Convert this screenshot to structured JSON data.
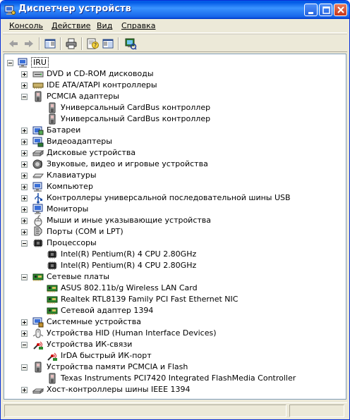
{
  "window": {
    "title": "Диспетчер устройств",
    "title_color": "#ffffff",
    "titlebar_color": "#0058e6"
  },
  "menu": [
    {
      "label": "Консоль",
      "name": "menu-console"
    },
    {
      "label": "Действие",
      "name": "menu-action"
    },
    {
      "label": "Вид",
      "name": "menu-view"
    },
    {
      "label": "Справка",
      "name": "menu-help"
    }
  ],
  "toolbar": [
    {
      "icon": "back-arrow-icon"
    },
    {
      "icon": "forward-arrow-icon"
    },
    {
      "icon": "show-hide-console-tree-icon"
    },
    {
      "icon": "print-icon"
    },
    {
      "icon": "properties-help-icon"
    },
    {
      "icon": "export-list-icon"
    },
    {
      "icon": "scan-hardware-icon"
    }
  ],
  "tree": [
    {
      "level": 0,
      "label": "IRU",
      "icon": "computer-icon",
      "expander": "minus",
      "selected": true
    },
    {
      "level": 1,
      "label": "DVD и CD-ROM дисководы",
      "icon": "cdrom-icon",
      "expander": "plus"
    },
    {
      "level": 1,
      "label": "IDE ATA/ATAPI контроллеры",
      "icon": "ide-controller-icon",
      "expander": "plus"
    },
    {
      "level": 1,
      "label": "PCMCIA адаптеры",
      "icon": "pcmcia-icon",
      "expander": "minus"
    },
    {
      "level": 2,
      "label": "Универсальный CardBus контроллер",
      "icon": "pcmcia-icon",
      "expander": ""
    },
    {
      "level": 2,
      "label": "Универсальный CardBus контроллер",
      "icon": "pcmcia-icon",
      "expander": ""
    },
    {
      "level": 1,
      "label": "Батареи",
      "icon": "battery-icon",
      "expander": "plus"
    },
    {
      "level": 1,
      "label": "Видеоадаптеры",
      "icon": "display-adapter-icon",
      "expander": "plus"
    },
    {
      "level": 1,
      "label": "Дисковые устройства",
      "icon": "disk-drive-icon",
      "expander": "plus"
    },
    {
      "level": 1,
      "label": "Звуковые, видео и игровые устройства",
      "icon": "sound-icon",
      "expander": "plus"
    },
    {
      "level": 1,
      "label": "Клавиатуры",
      "icon": "keyboard-icon",
      "expander": "plus"
    },
    {
      "level": 1,
      "label": "Компьютер",
      "icon": "computer-icon",
      "expander": "plus"
    },
    {
      "level": 1,
      "label": "Контроллеры универсальной последовательной шины USB",
      "icon": "usb-icon",
      "expander": "plus"
    },
    {
      "level": 1,
      "label": "Мониторы",
      "icon": "monitor-icon",
      "expander": "plus"
    },
    {
      "level": 1,
      "label": "Мыши и иные указывающие устройства",
      "icon": "mouse-icon",
      "expander": "plus"
    },
    {
      "level": 1,
      "label": "Порты (COM и LPT)",
      "icon": "port-icon",
      "expander": "plus"
    },
    {
      "level": 1,
      "label": "Процессоры",
      "icon": "processor-icon",
      "expander": "minus"
    },
    {
      "level": 2,
      "label": "Intel(R) Pentium(R) 4 CPU 2.80GHz",
      "icon": "processor-icon",
      "expander": ""
    },
    {
      "level": 2,
      "label": "Intel(R) Pentium(R) 4 CPU 2.80GHz",
      "icon": "processor-icon",
      "expander": ""
    },
    {
      "level": 1,
      "label": "Сетевые платы",
      "icon": "network-card-icon",
      "expander": "minus"
    },
    {
      "level": 2,
      "label": "ASUS 802.11b/g Wireless LAN Card",
      "icon": "network-card-icon",
      "expander": ""
    },
    {
      "level": 2,
      "label": "Realtek RTL8139 Family PCI Fast Ethernet NIC",
      "icon": "network-card-icon",
      "expander": ""
    },
    {
      "level": 2,
      "label": "Сетевой адаптер 1394",
      "icon": "network-card-icon",
      "expander": ""
    },
    {
      "level": 1,
      "label": "Системные устройства",
      "icon": "system-device-icon",
      "expander": "plus"
    },
    {
      "level": 1,
      "label": "Устройства HID (Human Interface Devices)",
      "icon": "hid-icon",
      "expander": "plus"
    },
    {
      "level": 1,
      "label": "Устройства ИК-связи",
      "icon": "infrared-icon",
      "expander": "minus"
    },
    {
      "level": 2,
      "label": "IrDA быстрый ИК-порт",
      "icon": "infrared-icon",
      "expander": ""
    },
    {
      "level": 1,
      "label": "Устройства памяти PCMCIA и Flash",
      "icon": "pcmcia-icon",
      "expander": "minus"
    },
    {
      "level": 2,
      "label": "Texas Instruments PCI7420 Integrated FlashMedia Controller",
      "icon": "pcmcia-icon",
      "expander": ""
    },
    {
      "level": 1,
      "label": "Хост-контроллеры шины IEEE 1394",
      "icon": "ieee1394-icon",
      "expander": "plus"
    }
  ]
}
